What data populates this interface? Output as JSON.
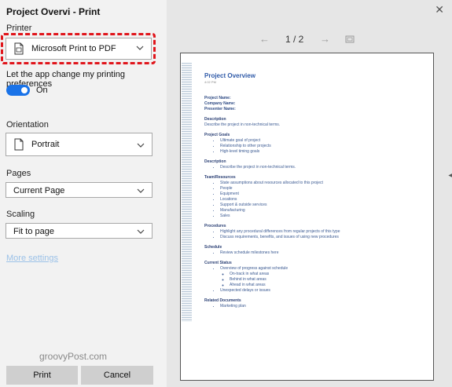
{
  "window": {
    "title": "Project Overvi - Print",
    "close_glyph": "✕"
  },
  "printer": {
    "label": "Printer",
    "selected": "Microsoft Print to PDF",
    "icon": "pdf-printer-icon"
  },
  "preferences": {
    "text": "Let the app change my printing preferences",
    "toggle_label": "On",
    "toggle_on": true
  },
  "orientation": {
    "label": "Orientation",
    "selected": "Portrait"
  },
  "pages": {
    "label": "Pages",
    "selected": "Current Page"
  },
  "scaling": {
    "label": "Scaling",
    "selected": "Fit to page"
  },
  "more_settings": "More settings",
  "watermark": "groovyPost.com",
  "buttons": {
    "print": "Print",
    "cancel": "Cancel"
  },
  "nav": {
    "prev": "←",
    "next": "→",
    "page_indicator": "1 / 2"
  },
  "colors": {
    "accent": "#1a73e8",
    "highlight_outline": "#e0151b",
    "link": "#9cc2e8"
  },
  "document": {
    "title": "Project Overview",
    "time": "4:02 PM",
    "project_name": "Project Name:",
    "company_name": "Company Name:",
    "presenter_name": "Presenter Name:",
    "sections": [
      {
        "heading": "Description",
        "body": "Describe the project in non-technical terms."
      },
      {
        "heading": "Project Goals",
        "items": [
          "Ultimate goal of project",
          "Relationship to other projects",
          "High-level timing goals"
        ]
      },
      {
        "heading": "Description",
        "items": [
          "Describe the project in non-technical terms."
        ]
      },
      {
        "heading": "Team/Resources",
        "items": [
          "State assumptions about resources allocated to this project",
          "People",
          "Equipment",
          "Locations",
          "Support & outside services",
          "Manufacturing",
          "Sales"
        ]
      },
      {
        "heading": "Procedures",
        "items": [
          "Highlight any procedural differences from regular projects of this type",
          "Discuss requirements, benefits, and issues of using new procedures"
        ]
      },
      {
        "heading": "Schedule",
        "items": [
          "Review schedule milestones here"
        ]
      },
      {
        "heading": "Current Status",
        "items": [
          "Overview of progress against schedule"
        ],
        "subitems": [
          "On-track in what areas",
          "Behind in what areas",
          "Ahead in what areas"
        ],
        "items_after": [
          "Unexpected delays or issues"
        ]
      },
      {
        "heading": "Related Documents",
        "items": [
          "Marketing plan"
        ]
      }
    ]
  }
}
